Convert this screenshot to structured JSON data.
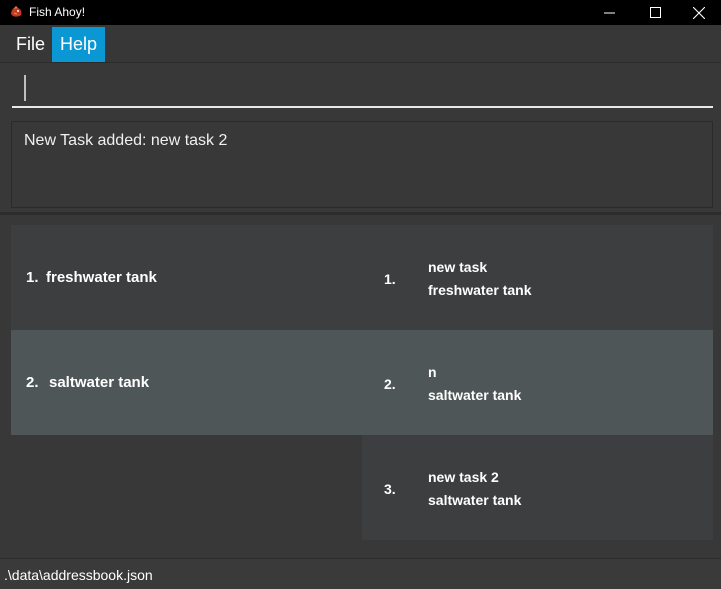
{
  "window": {
    "title": "Fish Ahoy!",
    "icon": "fish-app-icon"
  },
  "menu": {
    "file": "File",
    "help": "Help",
    "active_item": "Help",
    "accent_color": "#0b97d3"
  },
  "command": {
    "value": "",
    "placeholder": ""
  },
  "result": {
    "message": "New Task added: new task 2"
  },
  "tanks": [
    {
      "index": "1.",
      "name": "freshwater tank"
    },
    {
      "index": "2.",
      "name": "saltwater tank"
    }
  ],
  "tasks": [
    {
      "index": "1.",
      "description": "new task",
      "tank": "freshwater tank"
    },
    {
      "index": "2.",
      "description": "n",
      "tank": "saltwater tank"
    },
    {
      "index": "3.",
      "description": "new task 2",
      "tank": "saltwater tank"
    }
  ],
  "selected_row": 2,
  "status": {
    "path": ".\\data\\addressbook.json"
  }
}
